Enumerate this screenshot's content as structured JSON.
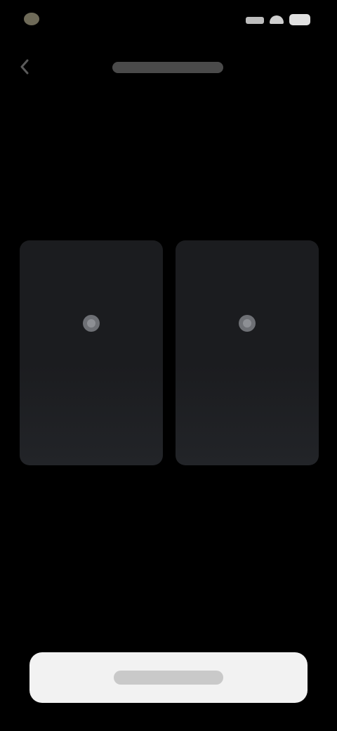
{
  "status_bar": {
    "time": "",
    "icons": [
      "signal-icon",
      "wifi-icon",
      "battery-icon"
    ]
  },
  "header": {
    "back_icon": "chevron-left-icon",
    "title": ""
  },
  "options": [
    {
      "icon": "sparkle-icon",
      "label": ""
    },
    {
      "icon": "sparkle-icon",
      "label": ""
    }
  ],
  "primary_button": {
    "label": ""
  },
  "colors": {
    "background": "#000000",
    "card": "#1b1c1f",
    "button": "#f2f2f2"
  }
}
